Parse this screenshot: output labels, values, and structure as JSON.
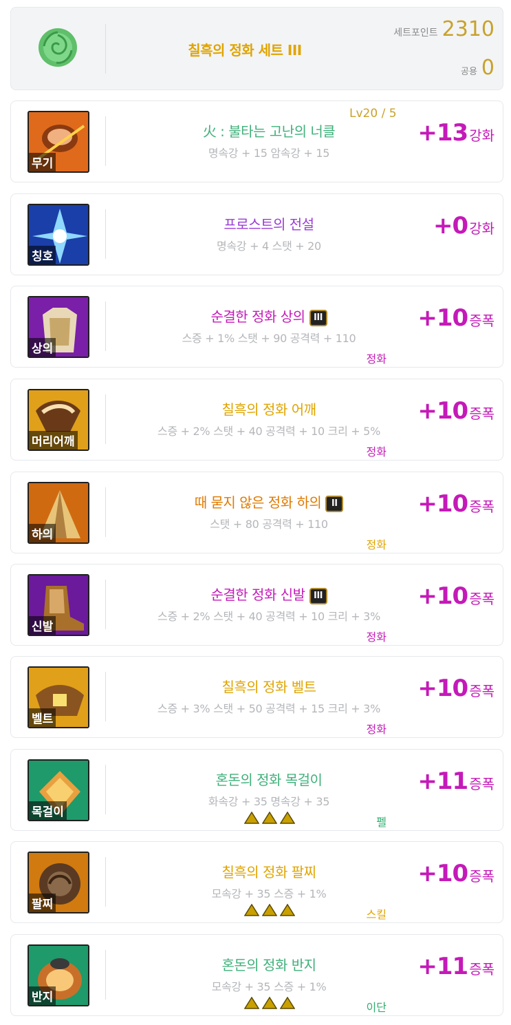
{
  "set": {
    "name": "칠흑의 정화 세트 III",
    "set_point_label": "세트포인트",
    "set_point_value": "2310",
    "shared_label": "공용",
    "shared_value": "0",
    "icon": "rose-icon"
  },
  "items": [
    {
      "slot": "무기",
      "name": "火 : 불타는 고난의 너클",
      "stats": "명속강 + 15 암속강 + 15",
      "level": "Lv20 / 5",
      "reinforce": "+13",
      "reinforce_type": "강화",
      "name_color": "#3fb07a",
      "icon": "knuckle-weapon-icon"
    },
    {
      "slot": "칭호",
      "name": "프로스트의 전설",
      "stats": "명속강 + 4 스탯 + 20",
      "reinforce": "+0",
      "reinforce_type": "강화",
      "name_color": "#9b3bd4",
      "icon": "frost-title-icon"
    },
    {
      "slot": "상의",
      "name": "순결한 정화 상의",
      "badge": "III",
      "stats": "스증 + 1% 스탯 + 90 공격력 + 110",
      "tag": "정화",
      "tag_color": "#c41ab8",
      "reinforce": "+10",
      "reinforce_type": "증폭",
      "name_color": "#c41ab8",
      "icon": "top-armor-icon"
    },
    {
      "slot": "머리어깨",
      "name": "칠흑의 정화 어깨",
      "stats": "스증 + 2% 스탯 + 40 공격력 + 10 크리 + 5%",
      "tag": "정화",
      "tag_color": "#c41ab8",
      "reinforce": "+10",
      "reinforce_type": "증폭",
      "name_color": "#e0a400",
      "icon": "shoulder-armor-icon"
    },
    {
      "slot": "하의",
      "name": "때 묻지 않은 정화 하의",
      "badge": "II",
      "stats": "스탯 + 80 공격력 + 110",
      "tag": "정화",
      "tag_color": "#e0a400",
      "reinforce": "+10",
      "reinforce_type": "증폭",
      "name_color": "#e07a00",
      "icon": "bottom-armor-icon"
    },
    {
      "slot": "신발",
      "name": "순결한 정화 신발",
      "badge": "III",
      "stats": "스증 + 2% 스탯 + 40 공격력 + 10 크리 + 3%",
      "tag": "정화",
      "tag_color": "#c41ab8",
      "reinforce": "+10",
      "reinforce_type": "증폭",
      "name_color": "#c41ab8",
      "icon": "shoes-armor-icon"
    },
    {
      "slot": "벨트",
      "name": "칠흑의 정화 벨트",
      "stats": "스증 + 3% 스탯 + 50 공격력 + 15 크리 + 3%",
      "tag": "정화",
      "tag_color": "#c41ab8",
      "reinforce": "+10",
      "reinforce_type": "증폭",
      "name_color": "#e0a400",
      "icon": "belt-armor-icon"
    },
    {
      "slot": "목걸이",
      "name": "혼돈의 정화 목걸이",
      "stats": "화속강 + 35 명속강 + 35",
      "tag": "펠",
      "tag_color": "#2fae6f",
      "triangles": 3,
      "reinforce": "+11",
      "reinforce_type": "증폭",
      "name_color": "#3fb07a",
      "icon": "necklace-icon"
    },
    {
      "slot": "팔찌",
      "name": "칠흑의 정화 팔찌",
      "stats": "모속강 + 35 스증 + 1%",
      "tag": "스킬",
      "tag_color": "#e0a400",
      "triangles": 3,
      "reinforce": "+10",
      "reinforce_type": "증폭",
      "name_color": "#e0a400",
      "icon": "bracelet-icon"
    },
    {
      "slot": "반지",
      "name": "혼돈의 정화 반지",
      "stats": "모속강 + 35 스증 + 1%",
      "tag": "이단",
      "tag_color": "#2fae6f",
      "triangles": 3,
      "reinforce": "+11",
      "reinforce_type": "증폭",
      "name_color": "#3fb07a",
      "icon": "ring-icon"
    }
  ]
}
